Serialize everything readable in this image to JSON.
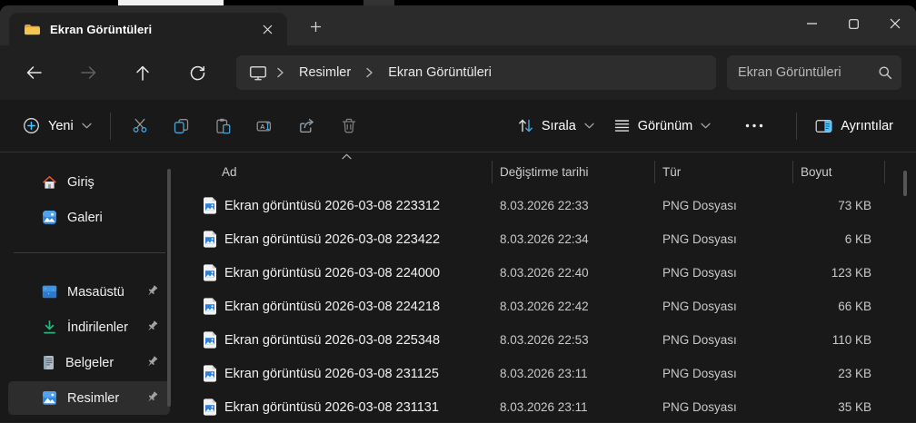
{
  "window": {
    "tab_title": "Ekran Görüntüleri"
  },
  "navigation": {
    "breadcrumb": {
      "root_icon": "this-pc-monitor",
      "items": [
        "Resimler",
        "Ekran Görüntüleri"
      ]
    },
    "search": {
      "placeholder": "Ekran Görüntüleri"
    }
  },
  "toolbar": {
    "new_label": "Yeni",
    "sort_label": "Sırala",
    "view_label": "Görünüm",
    "details_label": "Ayrıntılar"
  },
  "sidebar": {
    "items": [
      {
        "label": "Giriş",
        "icon": "home-icon",
        "pinned": false,
        "selected": false
      },
      {
        "label": "Galeri",
        "icon": "gallery-icon",
        "pinned": false,
        "selected": false
      },
      {
        "label": "Masaüstü",
        "icon": "desktop-icon",
        "pinned": true,
        "selected": false
      },
      {
        "label": "İndirilenler",
        "icon": "downloads-icon",
        "pinned": true,
        "selected": false
      },
      {
        "label": "Belgeler",
        "icon": "documents-icon",
        "pinned": true,
        "selected": false
      },
      {
        "label": "Resimler",
        "icon": "pictures-icon",
        "pinned": true,
        "selected": true
      }
    ]
  },
  "file_list": {
    "columns": [
      {
        "label": "Ad",
        "sorted": "asc"
      },
      {
        "label": "Değiştirme tarihi"
      },
      {
        "label": "Tür"
      },
      {
        "label": "Boyut"
      }
    ],
    "rows": [
      {
        "name": "Ekran görüntüsü 2026-03-08 223312",
        "date": "8.03.2026 22:33",
        "type": "PNG Dosyası",
        "size": "73 KB"
      },
      {
        "name": "Ekran görüntüsü 2026-03-08 223422",
        "date": "8.03.2026 22:34",
        "type": "PNG Dosyası",
        "size": "6 KB"
      },
      {
        "name": "Ekran görüntüsü 2026-03-08 224000",
        "date": "8.03.2026 22:40",
        "type": "PNG Dosyası",
        "size": "123 KB"
      },
      {
        "name": "Ekran görüntüsü 2026-03-08 224218",
        "date": "8.03.2026 22:42",
        "type": "PNG Dosyası",
        "size": "66 KB"
      },
      {
        "name": "Ekran görüntüsü 2026-03-08 225348",
        "date": "8.03.2026 22:53",
        "type": "PNG Dosyası",
        "size": "110 KB"
      },
      {
        "name": "Ekran görüntüsü 2026-03-08 231125",
        "date": "8.03.2026 23:11",
        "type": "PNG Dosyası",
        "size": "23 KB"
      },
      {
        "name": "Ekran görüntüsü 2026-03-08 231131",
        "date": "8.03.2026 23:11",
        "type": "PNG Dosyası",
        "size": "35 KB"
      }
    ]
  },
  "colors": {
    "accent": "#4cc2ff",
    "titlebar": "#2b2b2b",
    "surface": "#202020",
    "canvas": "#191919",
    "pill": "#2d2d2d",
    "selection": "#2d2d2d"
  }
}
